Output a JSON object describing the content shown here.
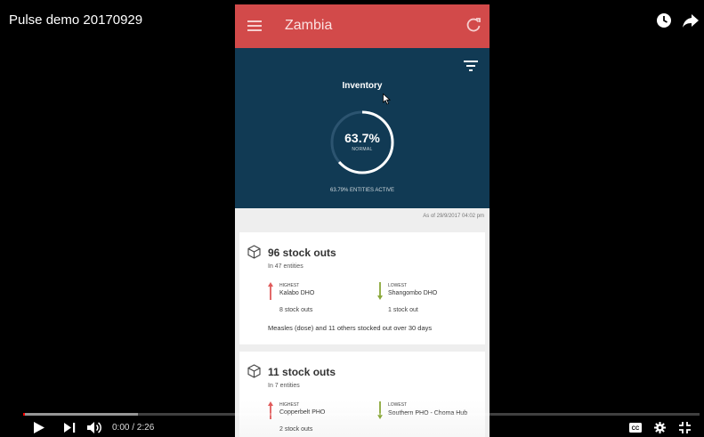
{
  "video": {
    "title": "Pulse demo 20170929",
    "time": "0:00 / 2:26",
    "progress_loaded": 0.17,
    "progress_played": 0.0
  },
  "app": {
    "title": "Zambia",
    "brand_color": "#d24a4a",
    "hero_color": "#113a54",
    "hero": {
      "label": "Inventory",
      "percent": "63.7%",
      "percent_value": 0.637,
      "status": "NORMAL",
      "entities_active": "63.79% ENTITIES ACTIVE"
    },
    "as_of": "As of 29/9/2017 04:02 pm",
    "cards": [
      {
        "title": "96 stock outs",
        "subtitle": "In 47 entities",
        "highest_label": "HIGHEST",
        "highest_name": "Kalabo DHO",
        "highest_count": "8 stock outs",
        "lowest_label": "LOWEST",
        "lowest_name": "Shangombo DHO",
        "lowest_count": "1 stock out",
        "footer": "Measles (dose) and 11 others stocked out over 30 days"
      },
      {
        "title": "11 stock outs",
        "subtitle": "In 7 entities",
        "highest_label": "HIGHEST",
        "highest_name": "Copperbelt PHO",
        "highest_count": "2 stock outs",
        "lowest_label": "LOWEST",
        "lowest_name": "Southern PHO - Choma Hub"
      }
    ]
  },
  "icons": {
    "menu": "hamburger-menu-icon",
    "refresh": "refresh-icon",
    "filter": "filter-icon",
    "box": "box-icon",
    "watch_later": "clock-icon",
    "share": "share-arrow-icon"
  }
}
